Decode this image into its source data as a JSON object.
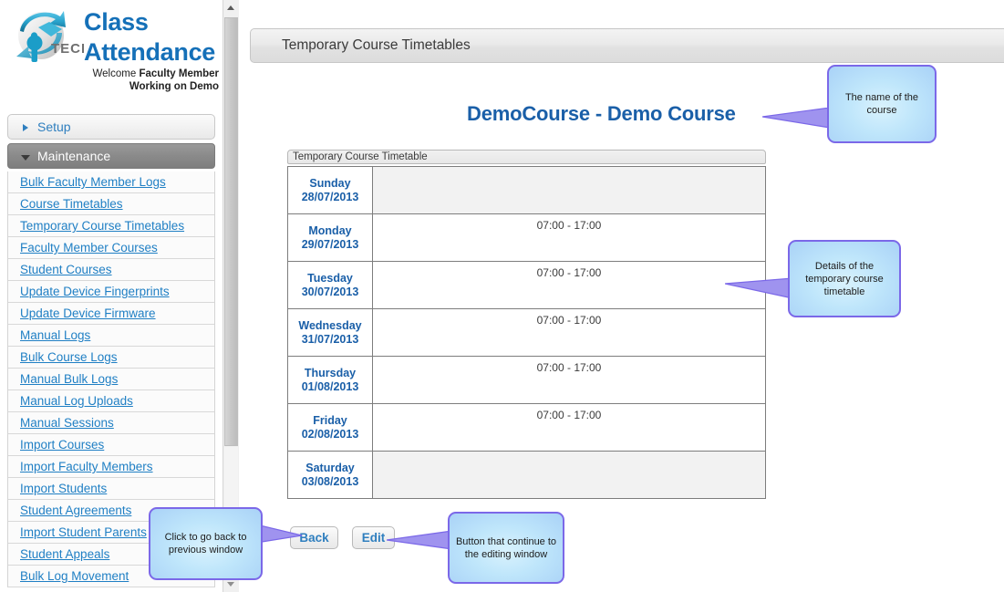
{
  "brand": {
    "logo_icon": "iptech-globe-logo",
    "line1": "Class",
    "line2": "Attendance",
    "welcome_prefix": "Welcome ",
    "welcome_user": "Faculty Member",
    "working_on": "Working on Demo"
  },
  "sidebar": {
    "groups": [
      {
        "label": "Setup",
        "expanded": false,
        "icon": "chevron-right-icon"
      },
      {
        "label": "Maintenance",
        "expanded": true,
        "icon": "chevron-down-icon"
      }
    ],
    "items": [
      {
        "label": "Bulk Faculty Member Logs"
      },
      {
        "label": "Course Timetables"
      },
      {
        "label": "Temporary Course Timetables"
      },
      {
        "label": "Faculty Member Courses"
      },
      {
        "label": "Student Courses"
      },
      {
        "label": "Update Device Fingerprints"
      },
      {
        "label": "Update Device Firmware"
      },
      {
        "label": "Manual Logs"
      },
      {
        "label": "Bulk Course Logs"
      },
      {
        "label": "Manual Bulk Logs"
      },
      {
        "label": "Manual Log Uploads"
      },
      {
        "label": "Manual Sessions"
      },
      {
        "label": "Import Courses"
      },
      {
        "label": "Import Faculty Members"
      },
      {
        "label": "Import Students"
      },
      {
        "label": "Student Agreements"
      },
      {
        "label": "Import Student Parents"
      },
      {
        "label": "Student Appeals"
      },
      {
        "label": "Bulk Log Movement"
      }
    ]
  },
  "main": {
    "page_title": "Temporary Course Timetables",
    "course_title": "DemoCourse - Demo Course",
    "table_caption": "Temporary Course Timetable",
    "rows": [
      {
        "day": "Sunday",
        "date": "28/07/2013",
        "time": ""
      },
      {
        "day": "Monday",
        "date": "29/07/2013",
        "time": "07:00 - 17:00"
      },
      {
        "day": "Tuesday",
        "date": "30/07/2013",
        "time": "07:00 - 17:00"
      },
      {
        "day": "Wednesday",
        "date": "31/07/2013",
        "time": "07:00 - 17:00"
      },
      {
        "day": "Thursday",
        "date": "01/08/2013",
        "time": "07:00 - 17:00"
      },
      {
        "day": "Friday",
        "date": "02/08/2013",
        "time": "07:00 - 17:00"
      },
      {
        "day": "Saturday",
        "date": "03/08/2013",
        "time": ""
      }
    ],
    "buttons": {
      "back": "Back",
      "edit": "Edit"
    }
  },
  "callouts": {
    "course_name": "The name of the course",
    "details": "Details of the temporary course timetable",
    "back": "Click to go back to previous window",
    "edit": "Button that continue to the editing window"
  },
  "scrollbar": {
    "up_icon": "chevron-up-icon",
    "down_icon": "chevron-down-icon"
  },
  "colors": {
    "link_blue": "#1f7fc4",
    "heading_blue": "#1a5fa8",
    "callout_border": "#7b68e8",
    "callout_fill": "#bfe6fb",
    "maintenance_bar": "#8a8a8a"
  }
}
